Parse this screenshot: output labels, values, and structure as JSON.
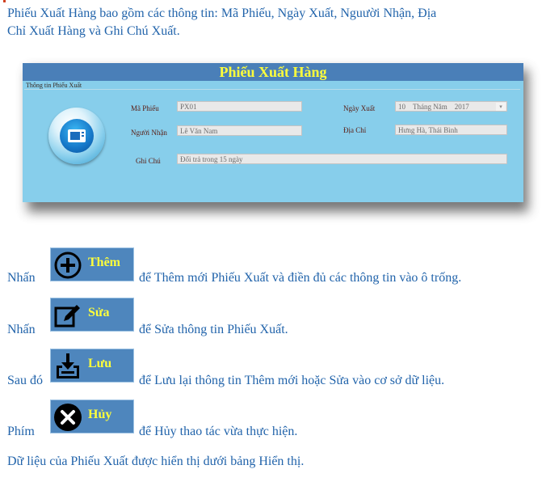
{
  "intro": {
    "line1": "Phiếu Xuất Hàng bao gồm các thông tin: Mã Phiếu, Ngày Xuất, Nguười Nhận, Địa",
    "line2": "Chỉ Xuất Hàng và Ghi Chú Xuất."
  },
  "form": {
    "title": "Phiếu Xuất Hàng",
    "group_label": "Thông tin Phiếu Xuất",
    "fields": {
      "ma_phieu": {
        "label": "Mã Phiếu",
        "value": "PX01"
      },
      "nguoi_nhan": {
        "label": "Người Nhận",
        "value": "Lê Văn Nam"
      },
      "ghi_chu": {
        "label": "Ghi Chú",
        "value": "Đổi trả trong 15 ngày"
      },
      "ngay_xuat": {
        "label": "Ngày Xuất",
        "day": "10",
        "month_text": "Tháng Năm",
        "year": "2017"
      },
      "dia_chi": {
        "label": "Địa Chỉ",
        "value": "Hưng Hà, Thái Bình"
      }
    }
  },
  "instructions": {
    "them": {
      "prefix": "Nhấn",
      "button": "Thêm",
      "suffix": "để Thêm mới Phiếu Xuất và điền đủ các thông tin vào ô trống."
    },
    "sua": {
      "prefix": "Nhấn",
      "button": "Sửa",
      "suffix": "để Sửa thông tin Phiếu Xuất."
    },
    "luu": {
      "prefix": "Sau đó",
      "button": "Lưu",
      "suffix": "để Lưu lại thông tin Thêm mới hoặc Sửa vào cơ sở dữ liệu."
    },
    "huy": {
      "prefix": "Phím",
      "button": "Hủy",
      "suffix": "để Hủy thao tác vừa thực hiện."
    }
  },
  "footer": "Dữ liệu của Phiếu Xuất được hiển thị dưới bảng Hiển thị.",
  "colors": {
    "text": "#2264ab",
    "form_bg": "#87ceeb",
    "title_bar": "#4a7fb8",
    "title_text": "#ffff3b",
    "button_bg": "#4e86bd"
  }
}
